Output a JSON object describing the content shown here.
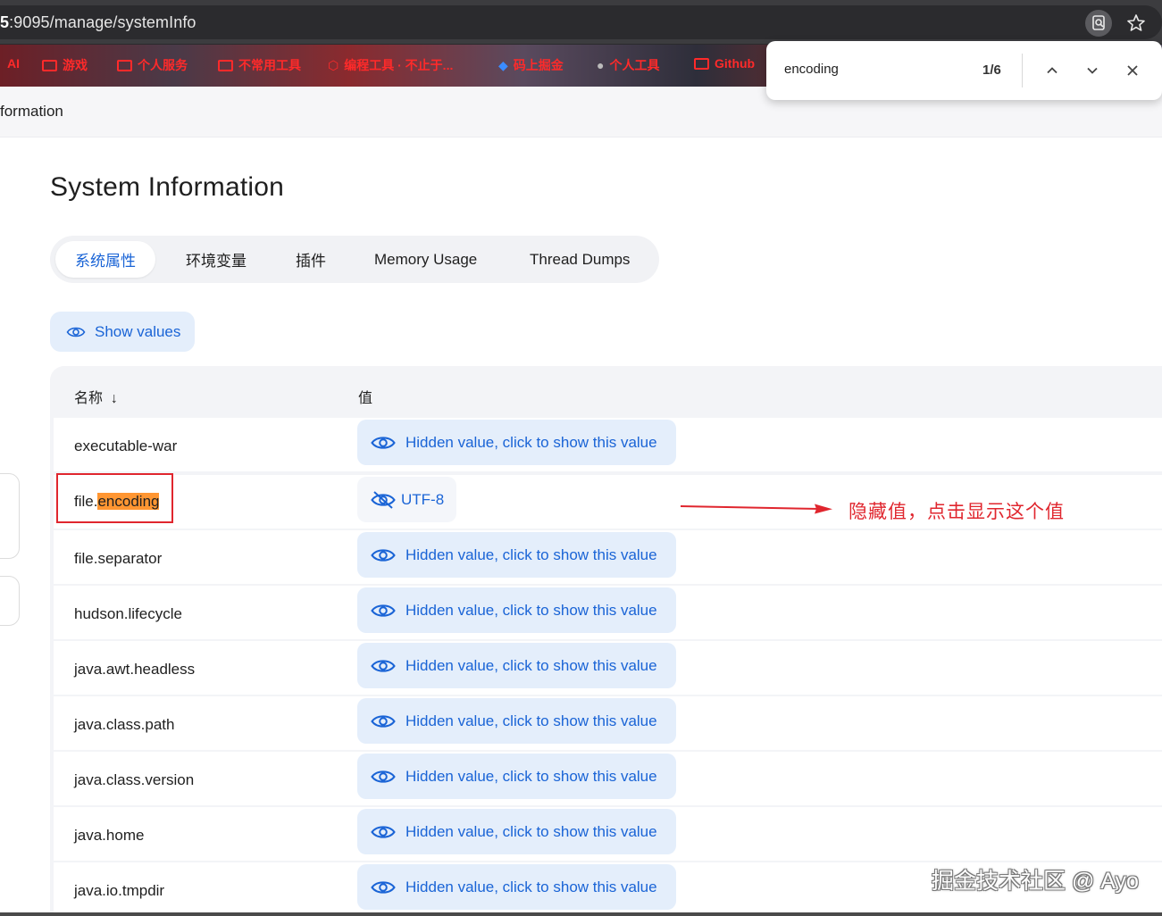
{
  "browser": {
    "url_prefix": "5",
    "url_path": ":9095/manage/systemInfo",
    "bookmarks": [
      {
        "label": "AI",
        "icon": "none"
      },
      {
        "label": "游戏",
        "icon": "folder-icon"
      },
      {
        "label": "个人服务",
        "icon": "folder-icon"
      },
      {
        "label": "不常用工具",
        "icon": "folder-icon"
      },
      {
        "label": "编程工具 · 不止于...",
        "icon": "cube-icon"
      },
      {
        "label": "码上掘金",
        "icon": "brand-icon"
      },
      {
        "label": "个人工具",
        "icon": "github-icon"
      },
      {
        "label": "Github",
        "icon": "folder-icon"
      }
    ],
    "tab_title": "formation"
  },
  "find_bar": {
    "query": "encoding",
    "count": "1/6"
  },
  "page": {
    "title": "System Information",
    "tabs": [
      {
        "label": "系统属性",
        "active": true
      },
      {
        "label": "环境变量",
        "active": false
      },
      {
        "label": "插件",
        "active": false
      },
      {
        "label": "Memory Usage",
        "active": false
      },
      {
        "label": "Thread Dumps",
        "active": false
      }
    ],
    "show_values_label": "Show values",
    "table": {
      "col_name": "名称",
      "sort_indicator": "↓",
      "col_value": "值",
      "hidden_label": "Hidden value, click to show this value",
      "rows": [
        {
          "name": "executable-war",
          "value": null
        },
        {
          "name_prefix": "file.",
          "name_match": "encoding",
          "value": "UTF-8"
        },
        {
          "name": "file.separator",
          "value": null
        },
        {
          "name": "hudson.lifecycle",
          "value": null
        },
        {
          "name": "java.awt.headless",
          "value": null
        },
        {
          "name": "java.class.path",
          "value": null
        },
        {
          "name": "java.class.version",
          "value": null
        },
        {
          "name": "java.home",
          "value": null
        },
        {
          "name": "java.io.tmpdir",
          "value": null
        }
      ]
    }
  },
  "annotation": {
    "text": "隐藏值，点击显示这个值",
    "color": "#e0262e"
  },
  "watermark": "掘金技术社区 @ Ayo",
  "colors": {
    "accent": "#1a64d6",
    "value_button_bg": "#e4eefb",
    "find_highlight": "#ff9632"
  }
}
